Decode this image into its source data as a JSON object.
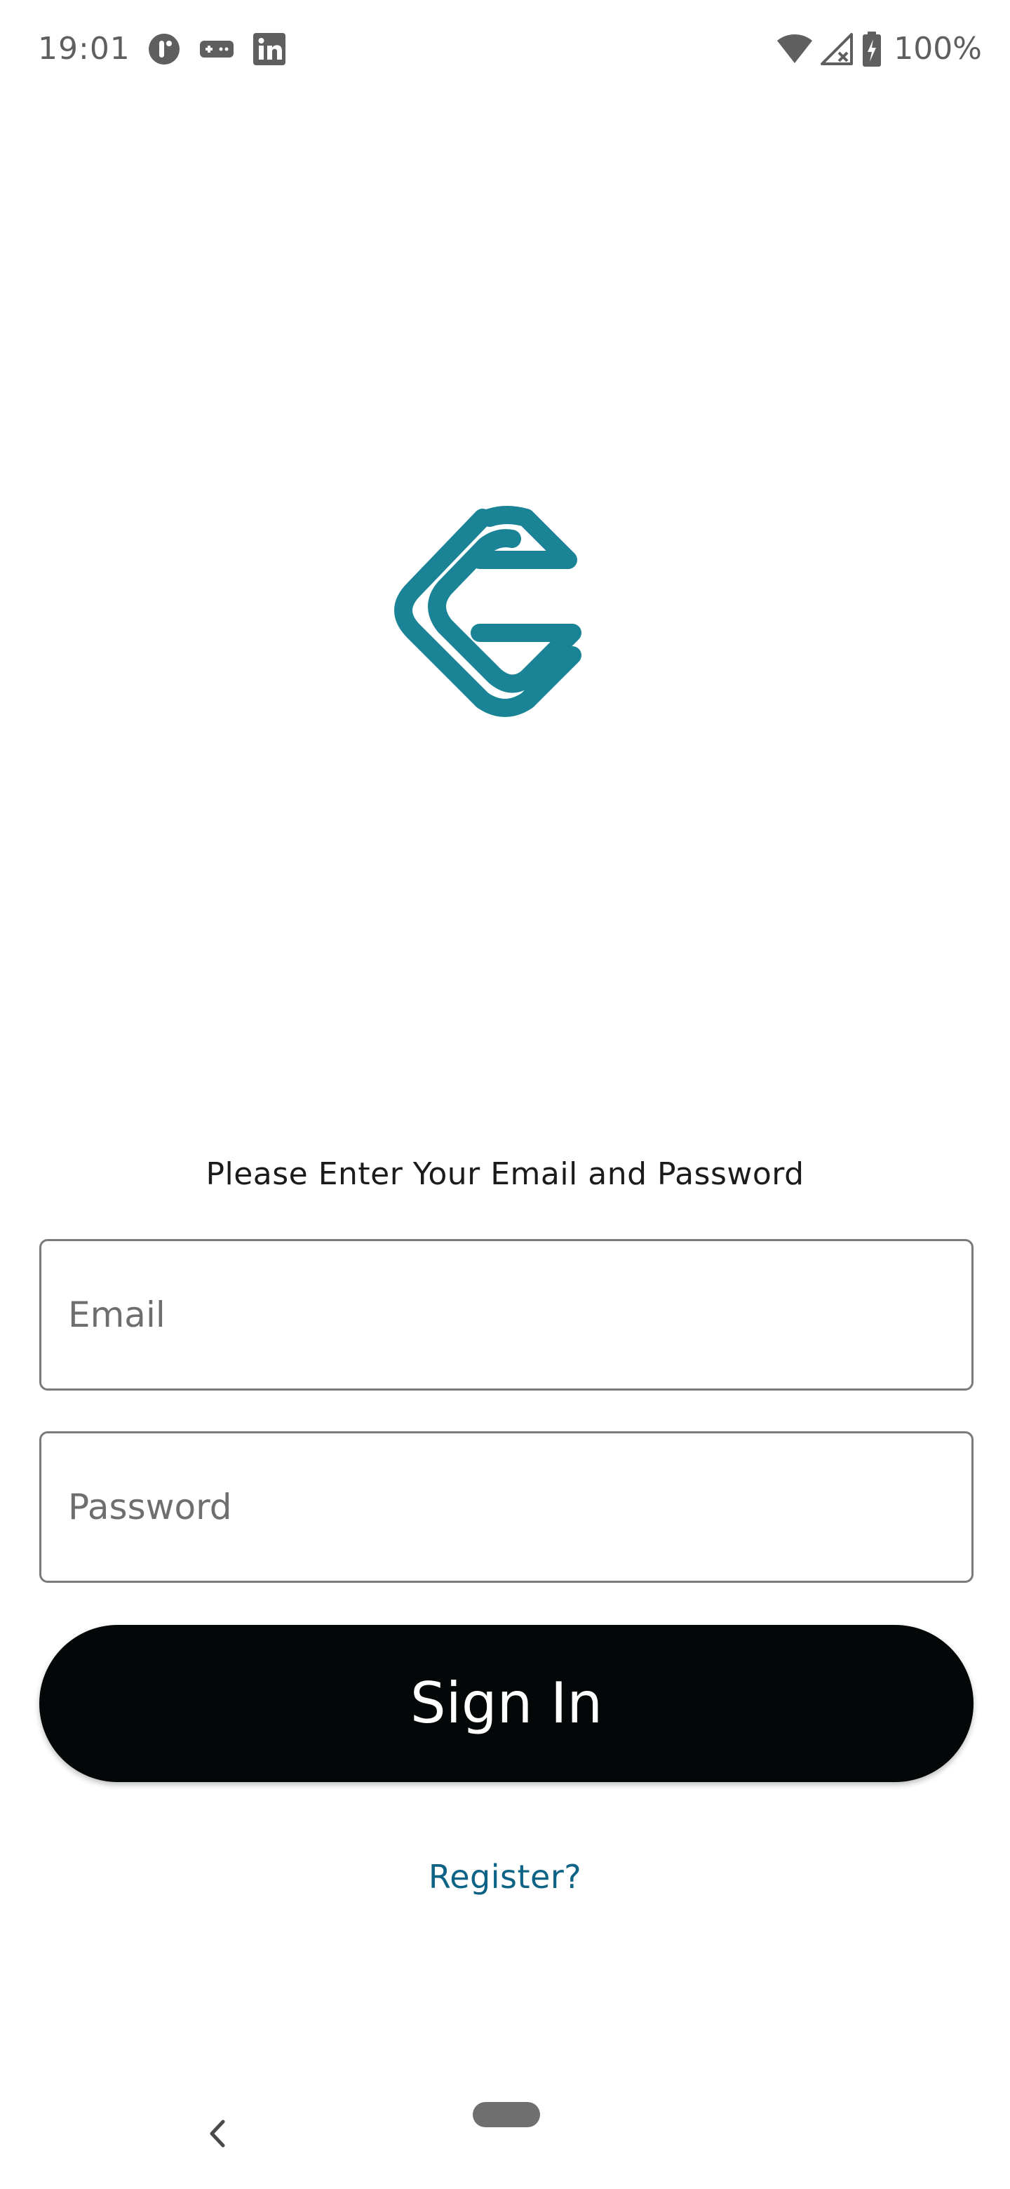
{
  "status_bar": {
    "time": "19:01",
    "left_icons": [
      "notification-app-icon",
      "gamepad-icon",
      "linkedin-icon"
    ],
    "right_icons": [
      "wifi-icon",
      "signal-no-service-icon",
      "battery-charging-icon"
    ],
    "battery_percent": "100%"
  },
  "logo": {
    "icon": "app-logo-icon",
    "color": "#1a8396"
  },
  "form": {
    "instruction": "Please Enter Your Email and Password",
    "email": {
      "placeholder": "Email",
      "value": ""
    },
    "password": {
      "placeholder": "Password",
      "value": ""
    },
    "sign_in_label": "Sign In",
    "register_label": "Register?"
  },
  "colors": {
    "button_background": "#030707",
    "button_text": "#ffffff",
    "link": "#0d6386",
    "field_border": "#7a7a7a"
  },
  "nav_bar": {
    "back_icon": "back-chevron-icon",
    "home_icon": "home-pill-icon"
  }
}
